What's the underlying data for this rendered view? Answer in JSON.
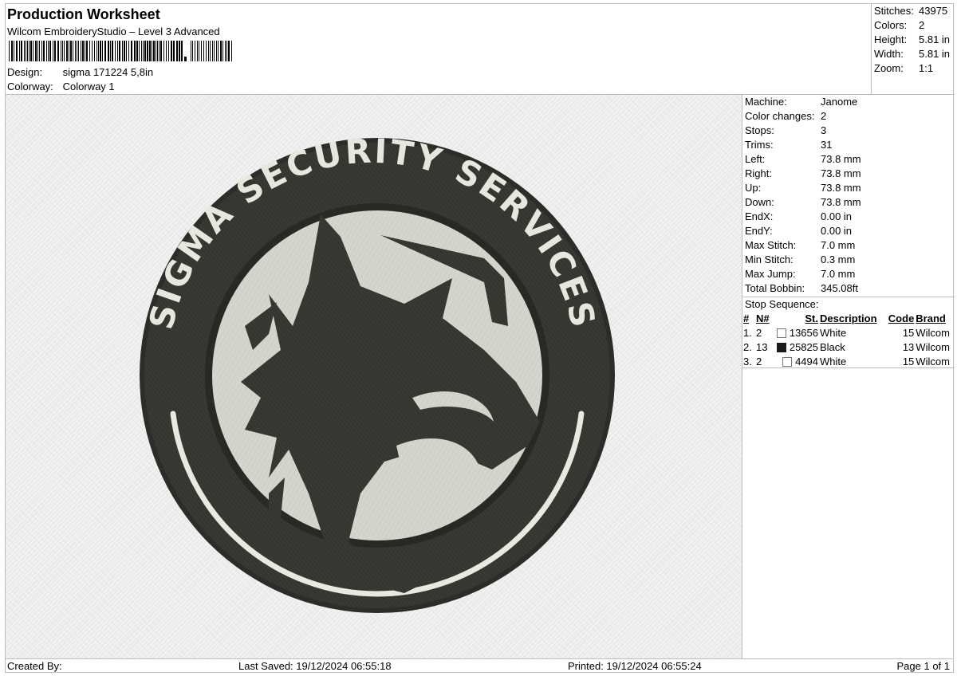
{
  "header": {
    "title": "Production Worksheet",
    "subtitle": "Wilcom EmbroideryStudio – Level 3 Advanced",
    "design_label": "Design:",
    "design_value": "sigma 171224 5,8in",
    "colorway_label": "Colorway:",
    "colorway_value": "Colorway 1"
  },
  "summary": [
    {
      "label": "Stitches:",
      "value": "43975"
    },
    {
      "label": "Colors:",
      "value": "2"
    },
    {
      "label": "Height:",
      "value": "5.81 in"
    },
    {
      "label": "Width:",
      "value": "5.81 in"
    },
    {
      "label": "Zoom:",
      "value": "1:1"
    }
  ],
  "details": [
    {
      "label": "Machine:",
      "value": "Janome"
    },
    {
      "label": "Color changes:",
      "value": "2"
    },
    {
      "label": "Stops:",
      "value": "3"
    },
    {
      "label": "Trims:",
      "value": "31"
    },
    {
      "label": "Left:",
      "value": "73.8 mm"
    },
    {
      "label": "Right:",
      "value": "73.8 mm"
    },
    {
      "label": "Up:",
      "value": "73.8 mm"
    },
    {
      "label": "Down:",
      "value": "73.8 mm"
    },
    {
      "label": "EndX:",
      "value": "0.00 in"
    },
    {
      "label": "EndY:",
      "value": "0.00 in"
    },
    {
      "label": "Max Stitch:",
      "value": "7.0 mm"
    },
    {
      "label": "Min Stitch:",
      "value": "0.3 mm"
    },
    {
      "label": "Max Jump:",
      "value": "7.0 mm"
    },
    {
      "label": "Total Bobbin:",
      "value": "345.08ft"
    }
  ],
  "stop_sequence": {
    "label": "Stop Sequence:",
    "headers": {
      "num": "#",
      "n": "N#",
      "st": "St.",
      "description": "Description",
      "code": "Code",
      "brand": "Brand"
    },
    "rows": [
      {
        "num": "1.",
        "n": "2",
        "swatch": "#ffffff",
        "st": "13656",
        "description": "White",
        "code": "15",
        "brand": "Wilcom"
      },
      {
        "num": "2.",
        "n": "13",
        "swatch": "#1a1a1a",
        "st": "25825",
        "description": "Black",
        "code": "13",
        "brand": "Wilcom"
      },
      {
        "num": "3.",
        "n": "2",
        "swatch": "#ffffff",
        "st": "4494",
        "description": "White",
        "code": "15",
        "brand": "Wilcom"
      }
    ]
  },
  "design": {
    "text": "SIGMA SECURITY SERVICES",
    "colors": {
      "dark": "#3a3833",
      "light": "#d4d6cd",
      "stitch_white": "#eceee6"
    }
  },
  "footer": {
    "created_by": "Created By:",
    "last_saved": "Last Saved: 19/12/2024 06:55:18",
    "printed": "Printed: 19/12/2024 06:55:24",
    "page": "Page 1 of 1"
  }
}
